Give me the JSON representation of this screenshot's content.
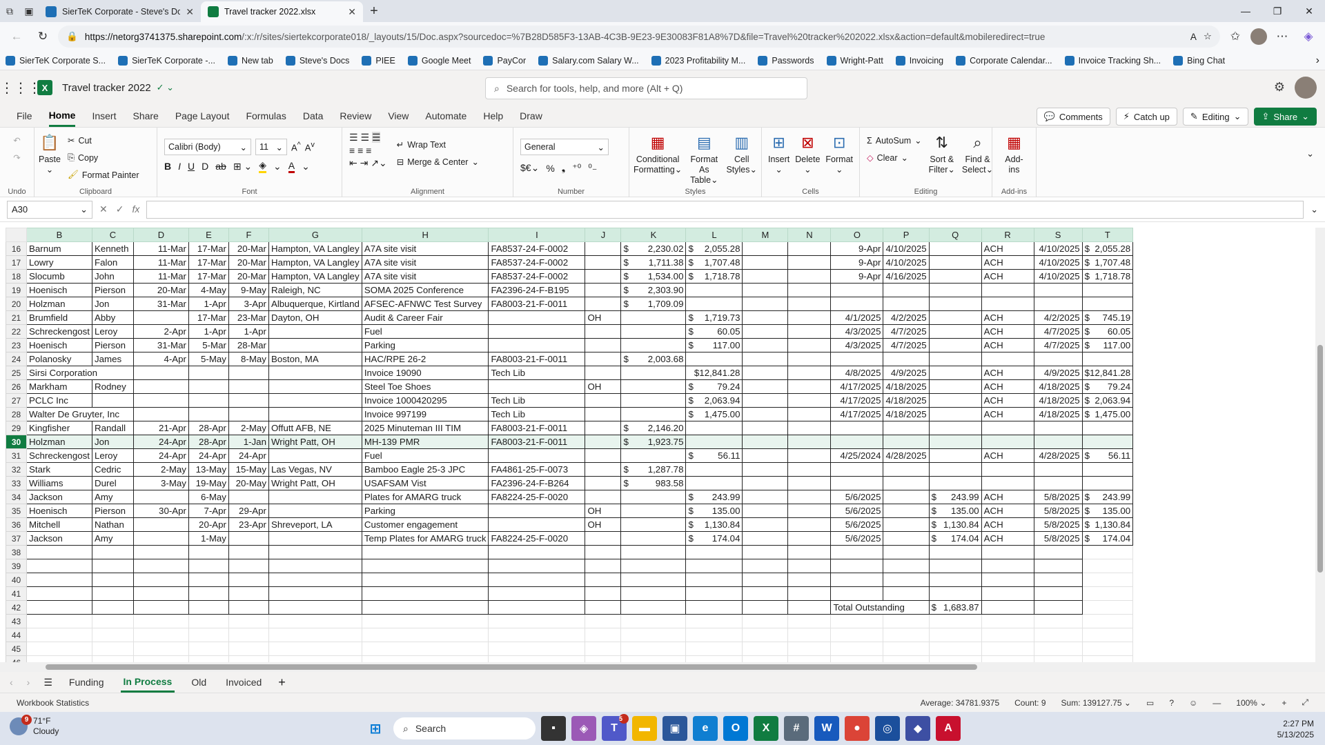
{
  "browser": {
    "tabs": [
      {
        "title": "SierTeK Corporate - Steve's Docs",
        "active": false,
        "color": "#1e6fb5"
      },
      {
        "title": "Travel tracker 2022.xlsx",
        "active": true,
        "color": "#107c41"
      }
    ],
    "url_host": "https://netorg3741375.sharepoint.com",
    "url_path": "/:x:/r/sites/siertekcorporate018/_layouts/15/Doc.aspx?sourcedoc=%7B28D585F3-13AB-4C3B-9E23-9E30083F81A8%7D&file=Travel%20tracker%202022.xlsx&action=default&mobileredirect=true",
    "favorites": [
      "SierTeK Corporate S...",
      "SierTeK Corporate -...",
      "New tab",
      "Steve's Docs",
      "PIEE",
      "Google Meet",
      "PayCor",
      "Salary.com Salary W...",
      "2023 Profitability M...",
      "Passwords",
      "Wright-Patt",
      "Invoicing",
      "Corporate Calendar...",
      "Invoice Tracking Sh...",
      "Bing Chat"
    ]
  },
  "excel": {
    "title": "Travel tracker 2022",
    "search_placeholder": "Search for tools, help, and more (Alt + Q)",
    "menu": [
      "File",
      "Home",
      "Insert",
      "Share",
      "Page Layout",
      "Formulas",
      "Data",
      "Review",
      "View",
      "Automate",
      "Help",
      "Draw"
    ],
    "active_menu": "Home",
    "buttons": {
      "comments": "Comments",
      "catchup": "Catch up",
      "editing": "Editing",
      "share": "Share"
    }
  },
  "ribbon": {
    "undo": "Undo",
    "clipboard": {
      "name": "Clipboard",
      "paste": "Paste",
      "cut": "Cut",
      "copy": "Copy",
      "format_painter": "Format Painter"
    },
    "font": {
      "name": "Font",
      "family": "Calibri (Body)",
      "size": "11"
    },
    "alignment": {
      "name": "Alignment",
      "wrap": "Wrap Text",
      "merge": "Merge & Center"
    },
    "number": {
      "name": "Number",
      "format": "General",
      "currency": "$€"
    },
    "styles": {
      "name": "Styles",
      "cond1": "Conditional",
      "cond2": "Formatting",
      "fmt1": "Format As",
      "fmt2": "Table",
      "cell1": "Cell",
      "cell2": "Styles"
    },
    "cells": {
      "name": "Cells",
      "insert": "Insert",
      "delete": "Delete",
      "format": "Format"
    },
    "editing": {
      "name": "Editing",
      "autosum": "AutoSum",
      "clear": "Clear",
      "sort1": "Sort &",
      "sort2": "Filter",
      "find1": "Find &",
      "find2": "Select"
    },
    "addins": {
      "name": "Add-ins",
      "label1": "Add-",
      "label2": "ins"
    }
  },
  "formula_bar": {
    "cell_ref": "A30",
    "fx": "fx",
    "value": ""
  },
  "columns": [
    "B",
    "C",
    "D",
    "E",
    "F",
    "G",
    "H",
    "I",
    "J",
    "K",
    "L",
    "M",
    "N",
    "O",
    "P",
    "Q",
    "R",
    "S",
    "T"
  ],
  "rows": [
    {
      "n": "16",
      "c": [
        "Barnum",
        "Kenneth",
        "11-Mar",
        "17-Mar",
        "20-Mar",
        "Hampton, VA Langley",
        "A7A site visit",
        "FA8537-24-F-0002",
        "",
        "2,230.02",
        "2,055.28",
        "",
        "",
        "9-Apr",
        "4/10/2025",
        "",
        "ACH",
        "4/10/2025",
        "2,055.28"
      ]
    },
    {
      "n": "17",
      "c": [
        "Lowry",
        "Falon",
        "11-Mar",
        "17-Mar",
        "20-Mar",
        "Hampton, VA Langley",
        "A7A site visit",
        "FA8537-24-F-0002",
        "",
        "1,711.38",
        "1,707.48",
        "",
        "",
        "9-Apr",
        "4/10/2025",
        "",
        "ACH",
        "4/10/2025",
        "1,707.48"
      ]
    },
    {
      "n": "18",
      "c": [
        "Slocumb",
        "John",
        "11-Mar",
        "17-Mar",
        "20-Mar",
        "Hampton, VA Langley",
        "A7A site visit",
        "FA8537-24-F-0002",
        "",
        "1,534.00",
        "1,718.78",
        "",
        "",
        "9-Apr",
        "4/16/2025",
        "",
        "ACH",
        "4/10/2025",
        "1,718.78"
      ]
    },
    {
      "n": "19",
      "c": [
        "Hoenisch",
        "Pierson",
        "20-Mar",
        "4-May",
        "9-May",
        "Raleigh, NC",
        "SOMA 2025 Conference",
        "FA2396-24-F-B195",
        "",
        "2,303.90",
        "",
        "",
        "",
        "",
        "",
        "",
        "",
        "",
        ""
      ]
    },
    {
      "n": "20",
      "c": [
        "Holzman",
        "Jon",
        "31-Mar",
        "1-Apr",
        "3-Apr",
        "Albuquerque, Kirtland",
        "AFSEC-AFNWC Test Survey",
        "FA8003-21-F-0011",
        "",
        "1,709.09",
        "",
        "",
        "",
        "",
        "",
        "",
        "",
        "",
        ""
      ]
    },
    {
      "n": "21",
      "c": [
        "Brumfield",
        "Abby",
        "",
        "17-Mar",
        "23-Mar",
        "Dayton, OH",
        "Audit & Career Fair",
        "",
        "OH",
        "",
        "1,719.73",
        "",
        "",
        "4/1/2025",
        "4/2/2025",
        "",
        "ACH",
        "4/2/2025",
        "745.19"
      ]
    },
    {
      "n": "22",
      "c": [
        "Schreckengost",
        "Leroy",
        "2-Apr",
        "1-Apr",
        "1-Apr",
        "",
        "Fuel",
        "",
        "",
        "",
        "60.05",
        "",
        "",
        "4/3/2025",
        "4/7/2025",
        "",
        "ACH",
        "4/7/2025",
        "60.05"
      ]
    },
    {
      "n": "23",
      "c": [
        "Hoenisch",
        "Pierson",
        "31-Mar",
        "5-Mar",
        "28-Mar",
        "",
        "Parking",
        "",
        "",
        "",
        "117.00",
        "",
        "",
        "4/3/2025",
        "4/7/2025",
        "",
        "ACH",
        "4/7/2025",
        "117.00"
      ]
    },
    {
      "n": "24",
      "c": [
        "Polanosky",
        "James",
        "4-Apr",
        "5-May",
        "8-May",
        "Boston, MA",
        "HAC/RPE 26-2",
        "FA8003-21-F-0011",
        "",
        "2,003.68",
        "",
        "",
        "",
        "",
        "",
        "",
        "",
        "",
        ""
      ]
    },
    {
      "n": "25",
      "c": [
        "Sirsi Corporation",
        "",
        "",
        "",
        "",
        "",
        "Invoice 19090",
        "Tech Lib",
        "",
        "",
        "$12,841.28",
        "",
        "",
        "4/8/2025",
        "4/9/2025",
        "",
        "ACH",
        "4/9/2025",
        "$12,841.28"
      ]
    },
    {
      "n": "26",
      "c": [
        "Markham",
        "Rodney",
        "",
        "",
        "",
        "",
        "Steel Toe Shoes",
        "",
        "OH",
        "",
        "79.24",
        "",
        "",
        "4/17/2025",
        "4/18/2025",
        "",
        "ACH",
        "4/18/2025",
        "79.24"
      ]
    },
    {
      "n": "27",
      "c": [
        "PCLC Inc",
        "",
        "",
        "",
        "",
        "",
        "Invoice 1000420295",
        "Tech Lib",
        "",
        "",
        "2,063.94",
        "",
        "",
        "4/17/2025",
        "4/18/2025",
        "",
        "ACH",
        "4/18/2025",
        "2,063.94"
      ]
    },
    {
      "n": "28",
      "c": [
        "Walter De Gruyter, Inc",
        "",
        "",
        "",
        "",
        "",
        "Invoice 997199",
        "Tech Lib",
        "",
        "",
        "1,475.00",
        "",
        "",
        "4/17/2025",
        "4/18/2025",
        "",
        "ACH",
        "4/18/2025",
        "1,475.00"
      ]
    },
    {
      "n": "29",
      "c": [
        "Kingfisher",
        "Randall",
        "21-Apr",
        "28-Apr",
        "2-May",
        "Offutt AFB, NE",
        "2025 Minuteman III TIM",
        "FA8003-21-F-0011",
        "",
        "2,146.20",
        "",
        "",
        "",
        "",
        "",
        "",
        "",
        "",
        ""
      ]
    },
    {
      "n": "30",
      "c": [
        "Holzman",
        "Jon",
        "24-Apr",
        "28-Apr",
        "1-Jan",
        "Wright Patt, OH",
        "MH-139 PMR",
        "FA8003-21-F-0011",
        "",
        "1,923.75",
        "",
        "",
        "",
        "",
        "",
        "",
        "",
        "",
        ""
      ]
    },
    {
      "n": "31",
      "c": [
        "Schreckengost",
        "Leroy",
        "24-Apr",
        "24-Apr",
        "24-Apr",
        "",
        "Fuel",
        "",
        "",
        "",
        "56.11",
        "",
        "",
        "4/25/2024",
        "4/28/2025",
        "",
        "ACH",
        "4/28/2025",
        "56.11"
      ]
    },
    {
      "n": "32",
      "c": [
        "Stark",
        "Cedric",
        "2-May",
        "13-May",
        "15-May",
        "Las Vegas, NV",
        "Bamboo Eagle 25-3 JPC",
        "FA4861-25-F-0073",
        "",
        "1,287.78",
        "",
        "",
        "",
        "",
        "",
        "",
        "",
        "",
        ""
      ]
    },
    {
      "n": "33",
      "c": [
        "Williams",
        "Durel",
        "3-May",
        "19-May",
        "20-May",
        "Wright Patt, OH",
        "USAFSAM Vist",
        "FA2396-24-F-B264",
        "",
        "983.58",
        "",
        "",
        "",
        "",
        "",
        "",
        "",
        "",
        ""
      ]
    },
    {
      "n": "34",
      "c": [
        "Jackson",
        "Amy",
        "",
        "6-May",
        "",
        "",
        "Plates for AMARG truck",
        "FA8224-25-F-0020",
        "",
        "",
        "243.99",
        "",
        "",
        "5/6/2025",
        "",
        "243.99",
        "ACH",
        "5/8/2025",
        "243.99"
      ]
    },
    {
      "n": "35",
      "c": [
        "Hoenisch",
        "Pierson",
        "30-Apr",
        "7-Apr",
        "29-Apr",
        "",
        "Parking",
        "",
        "OH",
        "",
        "135.00",
        "",
        "",
        "5/6/2025",
        "",
        "135.00",
        "ACH",
        "5/8/2025",
        "135.00"
      ]
    },
    {
      "n": "36",
      "c": [
        "Mitchell",
        "Nathan",
        "",
        "20-Apr",
        "23-Apr",
        "Shreveport, LA",
        "Customer engagement",
        "",
        "OH",
        "",
        "1,130.84",
        "",
        "",
        "5/6/2025",
        "",
        "1,130.84",
        "ACH",
        "5/8/2025",
        "1,130.84"
      ]
    },
    {
      "n": "37",
      "c": [
        "Jackson",
        "Amy",
        "",
        "1-May",
        "",
        "",
        "Temp Plates for AMARG truck",
        "FA8224-25-F-0020",
        "",
        "",
        "174.04",
        "",
        "",
        "5/6/2025",
        "",
        "174.04",
        "ACH",
        "5/8/2025",
        "174.04"
      ]
    }
  ],
  "empty_rows": [
    "38",
    "39",
    "40",
    "41"
  ],
  "total_row": {
    "n": "42",
    "label": "Total Outstanding",
    "value": "1,683.87"
  },
  "trailing_rows": [
    "43",
    "44",
    "45",
    "46"
  ],
  "sheets": [
    "Funding",
    "In Process",
    "Old",
    "Invoiced"
  ],
  "active_sheet": "In Process",
  "status": {
    "left": "Workbook Statistics",
    "average": "Average: 34781.9375",
    "count": "Count: 9",
    "sum": "Sum: 139127.75",
    "zoom": "100%"
  },
  "taskbar": {
    "badge": "9",
    "temp": "71°F",
    "cond": "Cloudy",
    "search": "Search",
    "teams_badge": "5",
    "time": "2:27 PM",
    "date": "5/13/2025"
  }
}
